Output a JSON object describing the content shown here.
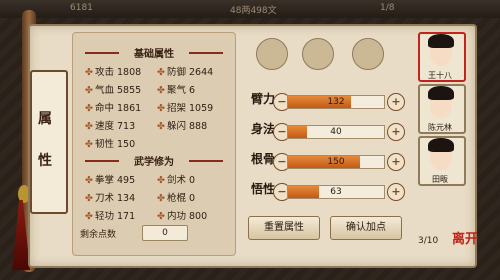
{
  "topbar": {
    "level": "6181",
    "money": "48两498文",
    "energy": "1/8"
  },
  "tab": {
    "char1": "属",
    "char2": "性"
  },
  "basic": {
    "title": "基础属性",
    "stats": [
      {
        "label": "攻击",
        "value": "1808"
      },
      {
        "label": "防御",
        "value": "2644"
      },
      {
        "label": "气血",
        "value": "5855"
      },
      {
        "label": "聚气",
        "value": "6"
      },
      {
        "label": "命中",
        "value": "1861"
      },
      {
        "label": "招架",
        "value": "1059"
      },
      {
        "label": "速度",
        "value": "713"
      },
      {
        "label": "躲闪",
        "value": "888"
      },
      {
        "label": "韧性",
        "value": "150"
      }
    ]
  },
  "martial": {
    "title": "武学修为",
    "stats": [
      {
        "label": "拳掌",
        "value": "495"
      },
      {
        "label": "剑术",
        "value": "0"
      },
      {
        "label": "刀术",
        "value": "134"
      },
      {
        "label": "枪棍",
        "value": "0"
      },
      {
        "label": "轻功",
        "value": "171"
      },
      {
        "label": "内功",
        "value": "800"
      }
    ]
  },
  "points": {
    "label": "剩余点数",
    "value": "0"
  },
  "attrs": [
    {
      "label": "臂力",
      "value": "132",
      "level": 0.66
    },
    {
      "label": "身法",
      "value": "40",
      "level": 0.2
    },
    {
      "label": "根骨",
      "value": "150",
      "level": 0.75
    },
    {
      "label": "悟性",
      "value": "63",
      "level": 0.32
    }
  ],
  "buttons": {
    "reset": "重置属性",
    "confirm": "确认加点"
  },
  "characters": [
    {
      "name": "王十八",
      "selected": true
    },
    {
      "name": "陈元林",
      "selected": false
    },
    {
      "name": "田畈",
      "selected": false
    }
  ],
  "pager": {
    "text": "3/10"
  },
  "logo": {
    "text": "离开"
  },
  "colors": {
    "bar": "#d8702a",
    "title": "#8a2a1a"
  }
}
